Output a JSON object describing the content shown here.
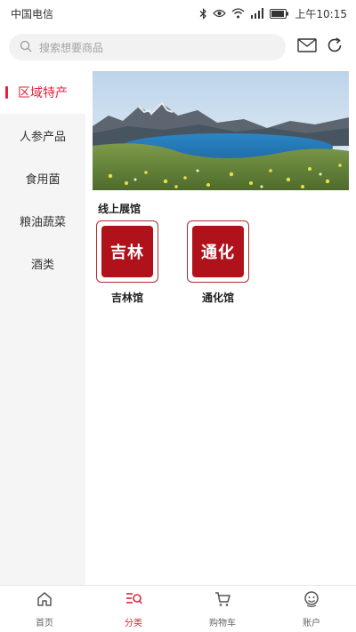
{
  "status_bar": {
    "carrier": "中国电信",
    "time": "上午10:15",
    "icons": [
      "bluetooth-icon",
      "eye-icon",
      "wifi-icon",
      "signal-icon",
      "battery-icon"
    ]
  },
  "search": {
    "placeholder": "搜索想要商品"
  },
  "header_actions": [
    "mail-icon",
    "refresh-icon"
  ],
  "sidebar": {
    "items": [
      {
        "label": "区域特产",
        "active": true
      },
      {
        "label": "人参产品",
        "active": false
      },
      {
        "label": "食用菌",
        "active": false
      },
      {
        "label": "粮油蔬菜",
        "active": false
      },
      {
        "label": "酒类",
        "active": false
      }
    ]
  },
  "main": {
    "section_title": "线上展馆",
    "venues": [
      {
        "logo_text": "吉林",
        "name": "吉林馆"
      },
      {
        "logo_text": "通化",
        "name": "通化馆"
      }
    ]
  },
  "tabs": [
    {
      "label": "首页",
      "icon": "home-icon",
      "active": false
    },
    {
      "label": "分类",
      "icon": "category-icon",
      "active": true
    },
    {
      "label": "购物车",
      "icon": "cart-icon",
      "active": false
    },
    {
      "label": "账户",
      "icon": "account-icon",
      "active": false
    }
  ],
  "colors": {
    "accent": "#e0243c",
    "logo_red": "#b0121c",
    "sidebar_bg": "#f5f5f5"
  }
}
